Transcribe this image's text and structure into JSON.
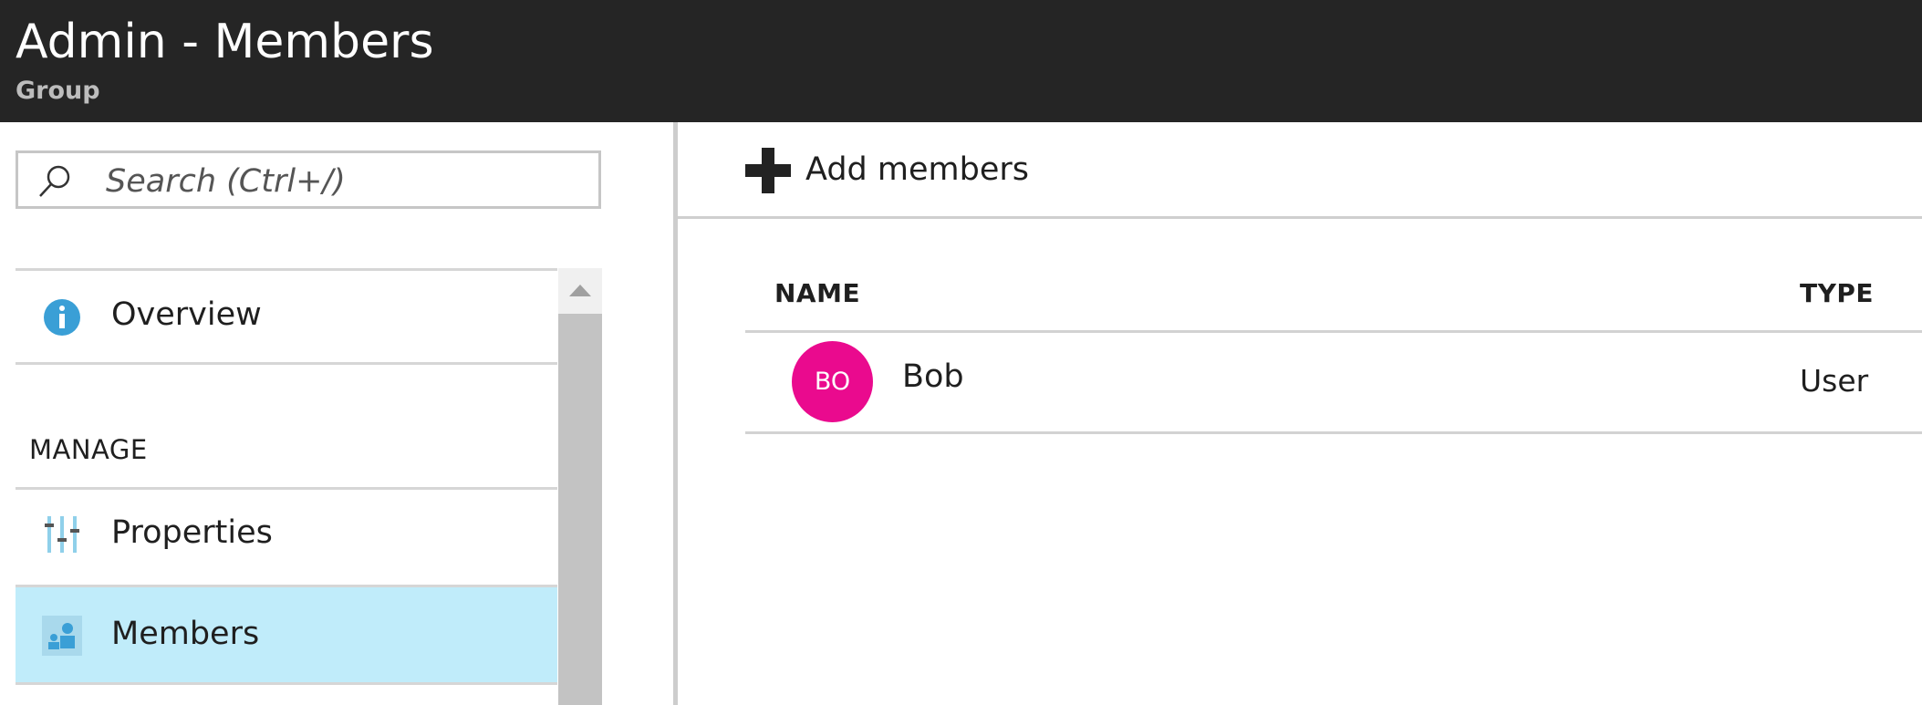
{
  "header": {
    "title": "Admin - Members",
    "subtitle": "Group"
  },
  "search": {
    "placeholder": "Search (Ctrl+/)",
    "icon": "search-icon"
  },
  "menu": {
    "overview": {
      "label": "Overview",
      "icon": "info-icon"
    },
    "manage_section": "MANAGE",
    "properties": {
      "label": "Properties",
      "icon": "properties-sliders-icon"
    },
    "members": {
      "label": "Members",
      "icon": "members-icon",
      "selected": true
    }
  },
  "toolbar": {
    "add_members_label": "Add members",
    "icon": "plus-icon"
  },
  "table": {
    "columns": [
      "NAME",
      "TYPE"
    ],
    "rows": [
      {
        "initials": "BO",
        "name": "Bob",
        "type": "User",
        "avatar_color": "#ea0a8e"
      }
    ]
  },
  "colors": {
    "header_bg": "#252525",
    "selected_bg": "#c0ecfa",
    "info_blue": "#3a9fd6"
  }
}
